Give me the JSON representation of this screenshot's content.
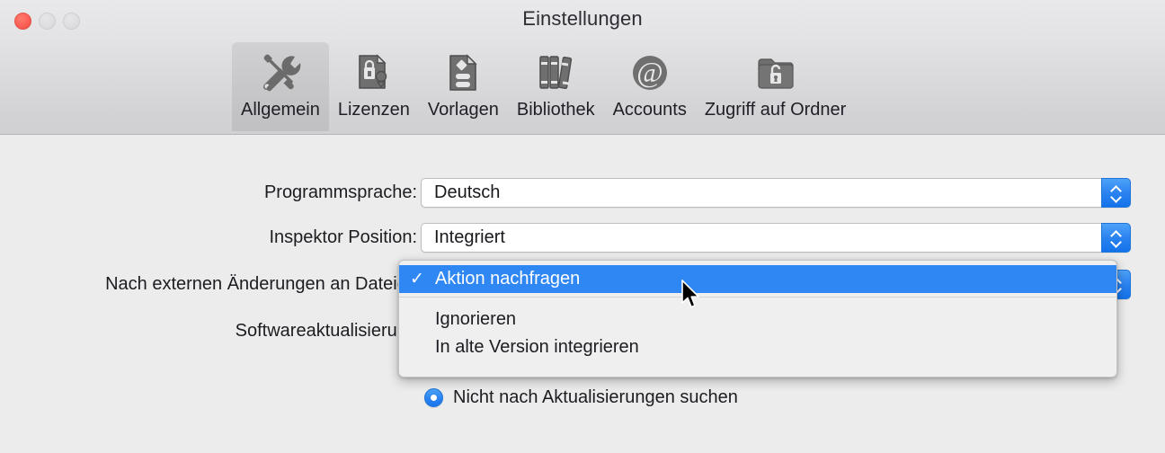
{
  "window": {
    "title": "Einstellungen",
    "traffic_lights": [
      "close",
      "minimize",
      "maximize"
    ]
  },
  "toolbar": {
    "items": [
      {
        "label": "Allgemein",
        "icon": "tools-icon",
        "selected": true
      },
      {
        "label": "Lizenzen",
        "icon": "document-lock-icon",
        "selected": false
      },
      {
        "label": "Vorlagen",
        "icon": "document-template-icon",
        "selected": false
      },
      {
        "label": "Bibliothek",
        "icon": "books-icon",
        "selected": false
      },
      {
        "label": "Accounts",
        "icon": "at-sign-icon",
        "selected": false
      },
      {
        "label": "Zugriff auf Ordner",
        "icon": "folder-lock-icon",
        "selected": false
      }
    ]
  },
  "form": {
    "rows": [
      {
        "label": "Programmsprache:",
        "value": "Deutsch"
      },
      {
        "label": "Inspektor Position:",
        "value": "Integriert"
      },
      {
        "label": "Nach externen Änderungen an Dateien",
        "value": "Aktion nachfragen"
      },
      {
        "label": "Softwareaktualisierung",
        "value": ""
      }
    ],
    "update_radio": {
      "label": "Nicht nach Aktualisierungen suchen",
      "selected": true
    }
  },
  "open_menu": {
    "checkmark": "✓",
    "items": [
      {
        "label": "Aktion nachfragen",
        "checked": true,
        "highlighted": true
      },
      {
        "label": "Ignorieren",
        "checked": false,
        "highlighted": false
      },
      {
        "label": "In alte Version integrieren",
        "checked": false,
        "highlighted": false
      }
    ]
  },
  "colors": {
    "accent_blue": "#2f87f3",
    "stepper_blue": "#2a82f0",
    "window_bg": "#ececec",
    "toolbar_bg": "#d4d3d6",
    "close_red": "#fc5f55"
  }
}
